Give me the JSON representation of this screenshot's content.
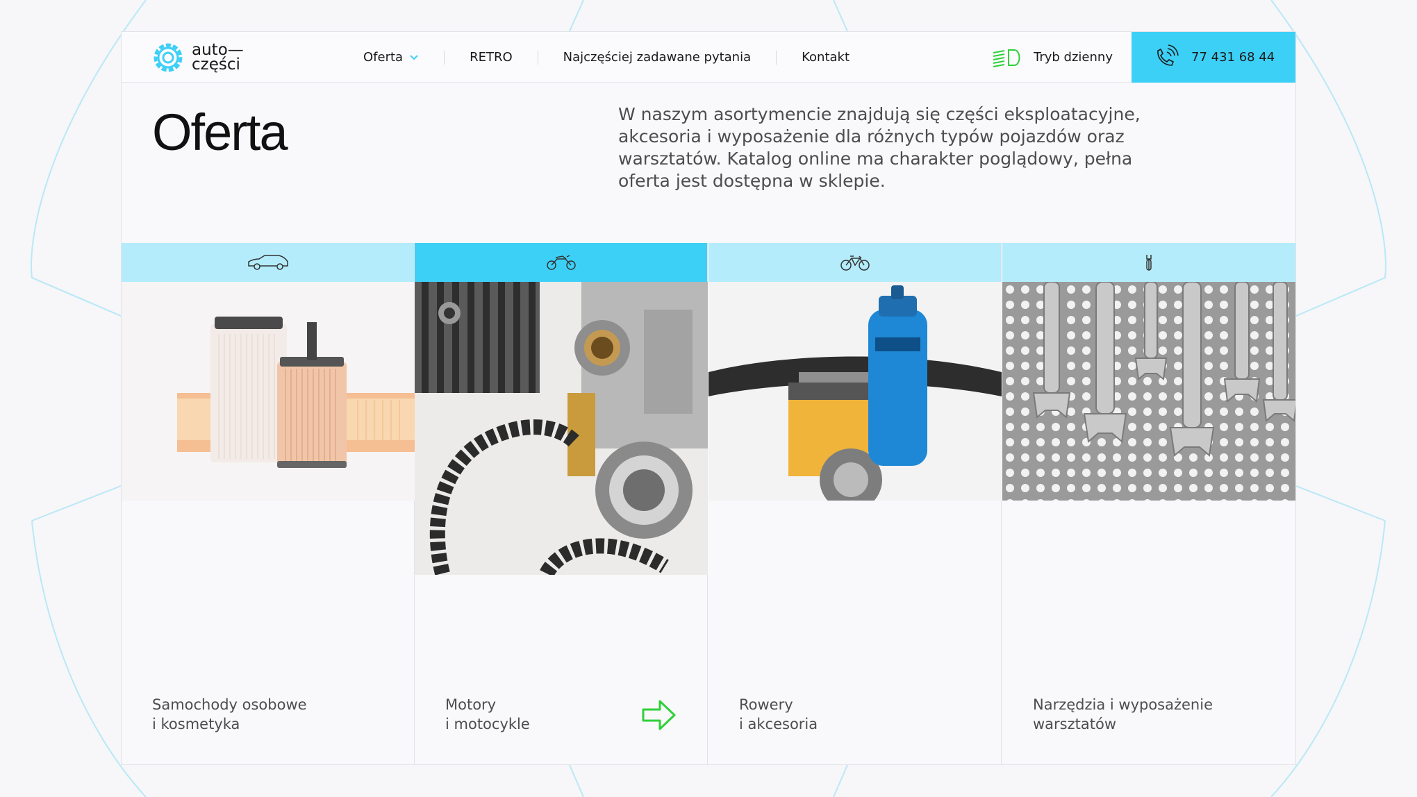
{
  "brand": {
    "name_line1": "auto—",
    "name_line2": "części",
    "accent_color": "#3dd0f7",
    "accent_light": "#b4ecfb",
    "arrow_color": "#2fd13a",
    "logo_icon": "gear-icon"
  },
  "nav": {
    "items": [
      {
        "label": "Oferta",
        "has_dropdown": true
      },
      {
        "label": "RETRO"
      },
      {
        "label": "Najczęściej zadawane pytania"
      },
      {
        "label": "Kontakt"
      }
    ],
    "mode_label": "Tryb dzienny",
    "mode_icon": "headlight-icon",
    "phone": "77 431 68 44",
    "phone_icon": "phone-icon"
  },
  "page": {
    "title": "Oferta",
    "intro": "W naszym asortymencie znajdują się części eksploatacyjne, akcesoria i wyposażenie dla różnych typów pojazdów oraz warsztatów. Katalog online ma charakter poglądowy, pełna oferta jest dostępna w sklepie."
  },
  "categories": [
    {
      "icon": "car-icon",
      "label_line1": "Samochody osobowe",
      "label_line2": "i kosmetyka",
      "active": false
    },
    {
      "icon": "motorcycle-icon",
      "label_line1": "Motory",
      "label_line2": "i motocykle",
      "active": true
    },
    {
      "icon": "bicycle-icon",
      "label_line1": "Rowery",
      "label_line2": "i akcesoria",
      "active": false
    },
    {
      "icon": "wrench-icon",
      "label_line1": "Narzędzia i wyposażenie",
      "label_line2": "warsztatów",
      "active": false
    }
  ]
}
